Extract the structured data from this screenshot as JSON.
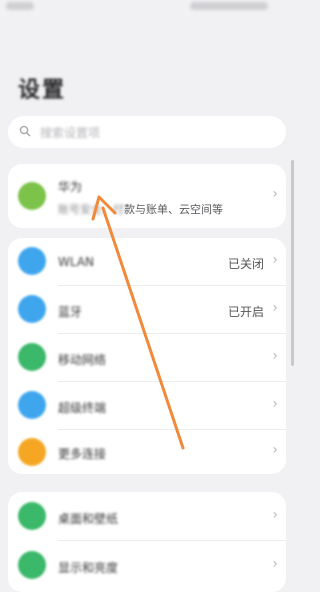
{
  "status_bar": {
    "left_blob": "",
    "right_blob": ""
  },
  "page_title": "设置",
  "search": {
    "placeholder": "搜索设置项",
    "icon": "search-icon"
  },
  "account": {
    "name": "华为",
    "subtitle_blurred": "账号安全、付",
    "subtitle_visible": "款与账单、云空间等",
    "avatar_color": "#7cc34a"
  },
  "connectivity": [
    {
      "label": "WLAN",
      "value": "已关闭",
      "color": "#3fa6ee"
    },
    {
      "label": "蓝牙",
      "value": "已开启",
      "color": "#3fa6ee"
    },
    {
      "label": "移动网络",
      "value": "",
      "color": "#3cb86a"
    },
    {
      "label": "超级终端",
      "value": "",
      "color": "#3fa6ee"
    },
    {
      "label": "更多连接",
      "value": "",
      "color": "#f5a623"
    }
  ],
  "display": [
    {
      "label": "桌面和壁纸",
      "color": "#3cb86a"
    },
    {
      "label": "显示和亮度",
      "color": "#3cb86a"
    }
  ],
  "annotation": {
    "color": "#f08a3a"
  }
}
